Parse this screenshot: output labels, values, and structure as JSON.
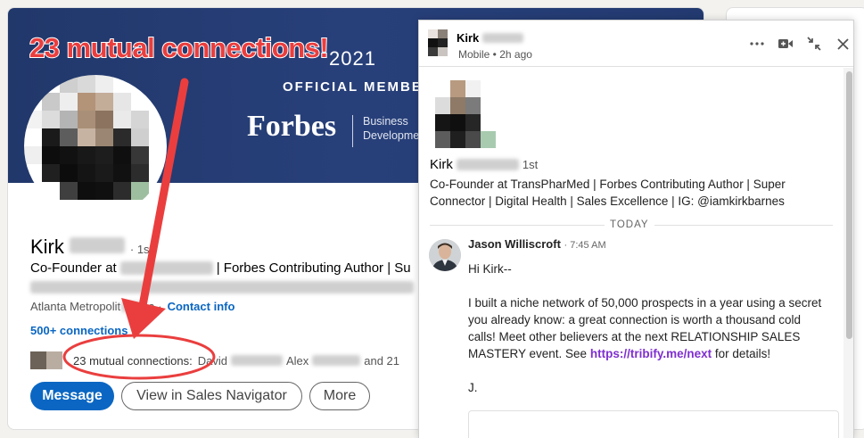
{
  "annotation": {
    "title": "23 mutual connections!"
  },
  "banner": {
    "year": "2021",
    "official": "OFFICIAL MEMBE",
    "brand": "Forbes",
    "subtitle": "Business\nDevelopme"
  },
  "profile": {
    "first_name": "Kirk",
    "degree": "· 1st",
    "headline_prefix": "Co-Founder at",
    "headline_suffix": "| Forbes Contributing Author | Su",
    "location": "Atlanta Metropolit",
    "location_end": "ea ·",
    "contact_info": "Contact info",
    "connections": "500+ connections",
    "mutual_text": "23 mutual connections:",
    "mutual_name1": "David",
    "mutual_name2": "Alex",
    "mutual_more": "and 21"
  },
  "buttons": {
    "message": "Message",
    "sales_navigator": "View in Sales Navigator",
    "more": "More"
  },
  "chat": {
    "header": {
      "name": "Kirk",
      "status": "Mobile  •  2h ago",
      "icons": {
        "more": "ellipsis-icon",
        "video": "video-call-icon",
        "minimize": "collapse-icon",
        "close": "close-icon"
      }
    },
    "intro": {
      "name": "Kirk",
      "degree": "1st",
      "headline": "Co-Founder at TransPharMed | Forbes Contributing Author | Super Connector | Digital Health | Sales Excellence | IG: @iamkirkbarnes"
    },
    "divider": "TODAY",
    "message": {
      "sender": "Jason Williscroft",
      "time": "· 7:45 AM",
      "greeting": "Hi Kirk--",
      "body_before_link": "I built a niche network of 50,000 prospects in a year using a secret you already know: a great connection is worth a thousand cold calls! Meet other believers at the next RELATIONSHIP SALES MASTERY event. See",
      "link": "https://tribify.me/next",
      "body_after_link": "for details!",
      "signoff": "J."
    }
  },
  "colors": {
    "brand_blue": "#0a66c2",
    "annotation_red": "#ea3e3e",
    "banner_navy": "#21386b",
    "link_purple": "#7f2fcf"
  }
}
